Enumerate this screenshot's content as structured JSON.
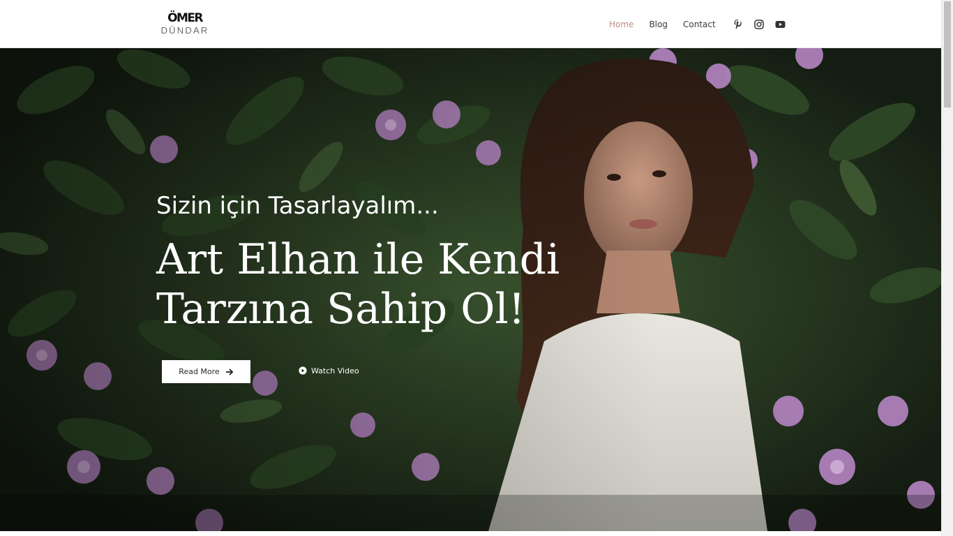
{
  "brand": {
    "logo_top": "ÖMER",
    "logo_bottom": "DÜNDAR"
  },
  "nav": {
    "items": [
      {
        "label": "Home",
        "active": true
      },
      {
        "label": "Blog",
        "active": false
      },
      {
        "label": "Contact",
        "active": false
      }
    ],
    "active_color": "#b98f86"
  },
  "social": {
    "icons": [
      "pinterest-icon",
      "instagram-icon",
      "youtube-icon"
    ]
  },
  "hero": {
    "subtitle": "Sizin için Tasarlayalım...",
    "title": "Art Elhan ile Kendi Tarzına Sahip Ol!",
    "read_more_label": "Read More",
    "watch_video_label": "Watch Video"
  }
}
